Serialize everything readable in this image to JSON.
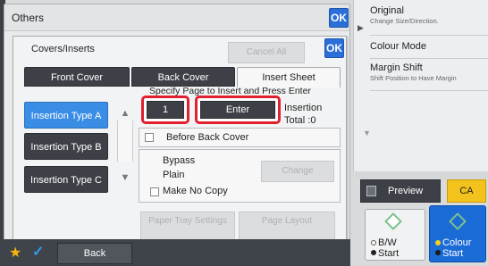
{
  "others_dialog": {
    "title": "Others",
    "ok_label": "OK"
  },
  "right_panel": {
    "items": [
      {
        "title": "Original",
        "subtitle": "Change Size/Direction."
      },
      {
        "title": "Colour Mode",
        "subtitle": ""
      },
      {
        "title": "Margin Shift",
        "subtitle": "Shift Position to Have Margin"
      }
    ]
  },
  "covers_dialog": {
    "title": "Covers/Inserts",
    "cancel_all_label": "Cancel All",
    "ok_label": "OK",
    "tabs": [
      {
        "label": "Front Cover",
        "active": false
      },
      {
        "label": "Back Cover",
        "active": false
      },
      {
        "label": "Insert Sheet",
        "active": true
      }
    ],
    "instruction": "Specify Page to Insert and Press Enter",
    "insertion_types": [
      "Insertion Type A",
      "Insertion Type B",
      "Insertion Type C"
    ],
    "page_value": "1",
    "enter_label": "Enter",
    "insertion_total_label": "Insertion",
    "insertion_total_value": "Total  :0",
    "before_back_cover_label": "Before Back Cover",
    "paper_source": "Bypass",
    "paper_type": "Plain",
    "make_no_copy_label": "Make No Copy",
    "change_label": "Change",
    "paper_tray_settings_label": "Paper Tray Settings",
    "page_layout_label": "Page Layout"
  },
  "bottom_bar": {
    "back_label": "Back"
  },
  "preview": {
    "preview_label": "Preview",
    "ca_label": "CA"
  },
  "start_buttons": {
    "bw_label_1": "B/W",
    "bw_label_2": "Start",
    "colour_label_1": "Colour",
    "colour_label_2": "Start"
  }
}
